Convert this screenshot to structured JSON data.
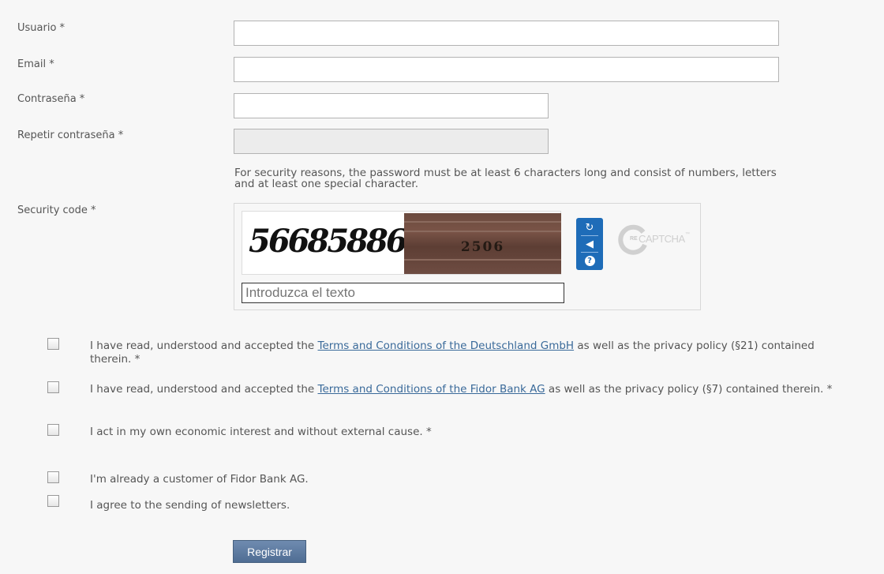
{
  "fields": {
    "username": {
      "label": "Usuario *",
      "value": ""
    },
    "email": {
      "label": "Email *",
      "value": ""
    },
    "password": {
      "label": "Contraseña *",
      "value": ""
    },
    "password_repeat": {
      "label": "Repetir contraseña *",
      "value": ""
    }
  },
  "password_hint": "For security reasons, the password must be at least 6 characters long and consist of numbers, letters and at least one special character.",
  "captcha": {
    "label": "Security code *",
    "word1": "56685886",
    "word2": "2506",
    "input_placeholder": "Introduzca el texto",
    "controls": [
      "refresh-icon",
      "audio-icon",
      "help-icon"
    ],
    "logo_prefix": "RE",
    "logo_text": "CAPTCHA",
    "logo_tm": "™"
  },
  "checkboxes": [
    {
      "pre": "I have read, understood and accepted the ",
      "link": "Terms and Conditions of the Deutschland GmbH",
      "post": " as well as the privacy policy (§21) contained therein. *",
      "checked": false
    },
    {
      "pre": "I have read, understood and accepted the ",
      "link": "Terms and Conditions of the Fidor Bank AG",
      "post": " as well as the privacy policy (§7) contained therein. *",
      "checked": false
    },
    {
      "pre": "I act in my own economic interest and without external cause. *",
      "checked": false
    },
    {
      "pre": "I'm already a customer of Fidor Bank AG.",
      "checked": false
    },
    {
      "pre": "I agree to the sending of newsletters.",
      "checked": false
    }
  ],
  "submit_label": "Registrar",
  "colors": {
    "link": "#3a6a9a",
    "button": "#5a7aa0",
    "captcha_panel": "#1e6cb8"
  }
}
